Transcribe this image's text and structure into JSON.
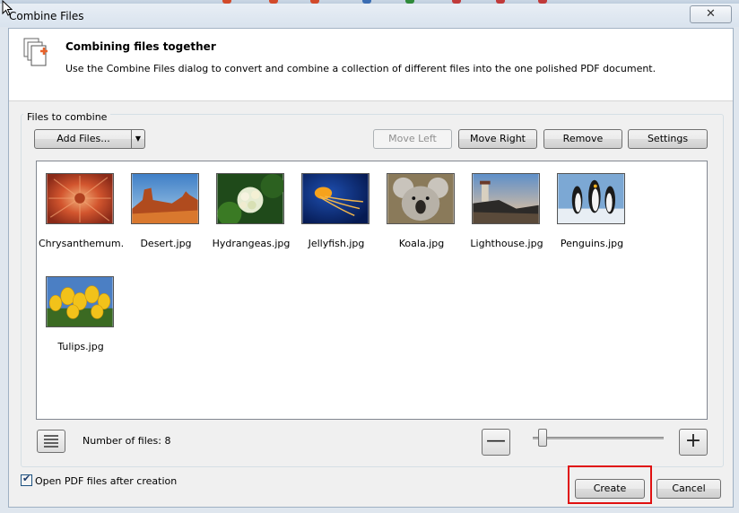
{
  "window": {
    "title": "Combine Files",
    "close_glyph": "✕"
  },
  "header": {
    "title": "Combining files together",
    "description": "Use the Combine Files dialog to convert and combine a collection of different files into the one polished PDF document.",
    "icon": "combine-files-icon"
  },
  "files_group": {
    "label": "Files to combine"
  },
  "toolbar": {
    "add_files": "Add Files...",
    "add_files_arrow": "▼",
    "move_left": "Move Left",
    "move_right": "Move Right",
    "remove": "Remove",
    "settings": "Settings"
  },
  "files": [
    {
      "name": "Chrysanthemum...",
      "selected": true
    },
    {
      "name": "Desert.jpg"
    },
    {
      "name": "Hydrangeas.jpg"
    },
    {
      "name": "Jellyfish.jpg"
    },
    {
      "name": "Koala.jpg"
    },
    {
      "name": "Lighthouse.jpg"
    },
    {
      "name": "Penguins.jpg"
    },
    {
      "name": "Tulips.jpg"
    }
  ],
  "footer": {
    "count_label": "Number of files: 8",
    "zoom_out": "—",
    "zoom_in": "+",
    "zoom_level": 0.1,
    "open_after_label": "Open PDF files after creation",
    "open_after_checked": true,
    "create": "Create",
    "cancel": "Cancel"
  },
  "colors": {
    "highlight": "#e01010",
    "accent": "#e8622a"
  }
}
